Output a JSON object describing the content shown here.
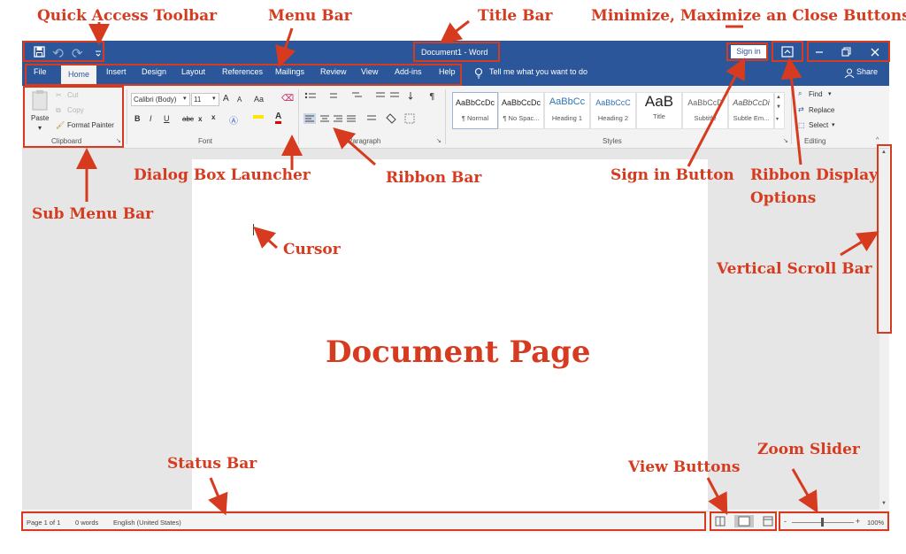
{
  "window": {
    "title": "Document1 - Word",
    "sign_in": "Sign in",
    "tell_me": "Tell me what you want to do",
    "share": "Share"
  },
  "tabs": [
    "File",
    "Home",
    "Insert",
    "Design",
    "Layout",
    "References",
    "Mailings",
    "Review",
    "View",
    "Add-ins",
    "Help"
  ],
  "clipboard": {
    "paste": "Paste",
    "cut": "Cut",
    "copy": "Copy",
    "format_painter": "Format Painter",
    "group_label": "Clipboard"
  },
  "font": {
    "family": "Calibri (Body)",
    "size": "11",
    "grow": "A",
    "shrink": "A",
    "case": "Aa",
    "bold": "B",
    "italic": "I",
    "underline": "U",
    "strike": "abc",
    "subscript": "x",
    "superscript": "x",
    "group_label": "Font"
  },
  "paragraph": {
    "group_label": "Paragraph"
  },
  "styles": {
    "items": [
      {
        "preview": "AaBbCcDc",
        "name": "¶ Normal"
      },
      {
        "preview": "AaBbCcDc",
        "name": "¶ No Spac..."
      },
      {
        "preview": "AaBbCc",
        "name": "Heading 1"
      },
      {
        "preview": "AaBbCcC",
        "name": "Heading 2"
      },
      {
        "preview": "AaB",
        "name": "Title"
      },
      {
        "preview": "AaBbCcD",
        "name": "Subtitle"
      },
      {
        "preview": "AaBbCcDi",
        "name": "Subtle Em..."
      }
    ],
    "group_label": "Styles"
  },
  "editing": {
    "find": "Find",
    "replace": "Replace",
    "select": "Select",
    "group_label": "Editing"
  },
  "status": {
    "page": "Page 1 of 1",
    "words": "0 words",
    "language": "English (United States)",
    "zoom_minus": "-",
    "zoom_plus": "+",
    "zoom": "100%"
  },
  "document": {
    "label": "Document Page"
  },
  "annotations": {
    "quick_access_toolbar": "Quick Access Toolbar",
    "menu_bar": "Menu Bar",
    "title_bar": "Title Bar",
    "window_buttons": "Minimize, Maximize an Close Buttons",
    "dialog_box_launcher": "Dialog Box Launcher",
    "ribbon_bar": "Ribbon Bar",
    "sign_in_button": "Sign in Button",
    "ribbon_display_1": "Ribbon Display",
    "ribbon_display_2": "Options",
    "sub_menu_bar": "Sub Menu Bar",
    "cursor": "Cursor",
    "vertical_scroll_bar": "Vertical Scroll Bar",
    "status_bar": "Status Bar",
    "view_buttons": "View Buttons",
    "zoom_slider": "Zoom Slider"
  },
  "colors": {
    "word_blue": "#2b579a",
    "annotation_red": "#d63b1f",
    "ribbon_gray": "#f3f3f3"
  }
}
